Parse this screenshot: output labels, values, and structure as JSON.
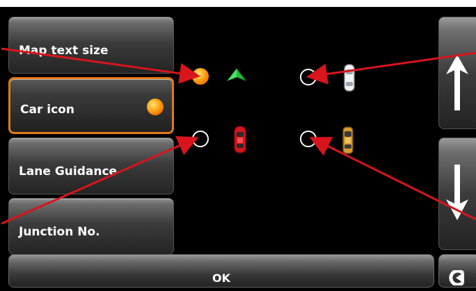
{
  "menu": {
    "items": [
      {
        "label": "Map text size"
      },
      {
        "label": "Car icon"
      },
      {
        "label": "Lane Guidance"
      },
      {
        "label": "Junction No."
      }
    ]
  },
  "icon_options": [
    {
      "icon": "green-arrow-icon",
      "selected": true
    },
    {
      "icon": "white-car-icon",
      "selected": false
    },
    {
      "icon": "red-car-icon",
      "selected": false
    },
    {
      "icon": "yellow-car-icon",
      "selected": false
    }
  ],
  "footer": {
    "ok_label": "OK"
  },
  "colors": {
    "selection_orange": "#f07a00",
    "selected_border": "#e07a18",
    "annotation_red": "#d8141c"
  }
}
